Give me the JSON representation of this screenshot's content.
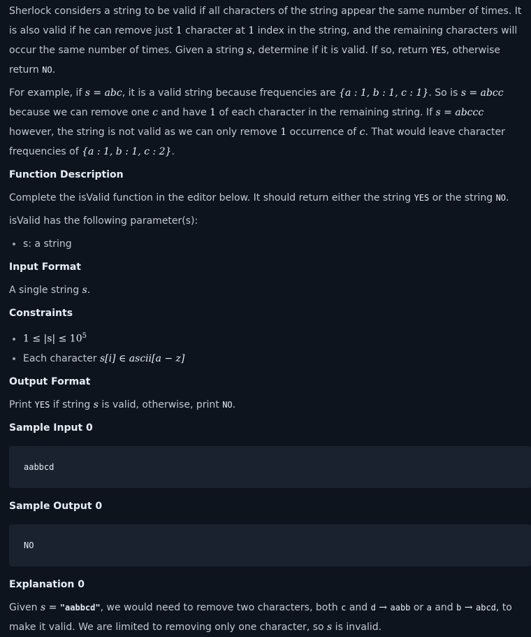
{
  "intro": {
    "p1": {
      "t1": "Sherlock considers a string to be valid if all characters of the string appear the same number of times. It is also valid if he can remove just ",
      "m1": "1",
      "t2": " character at ",
      "m2": "1",
      "t3": " index in the string, and the remaining characters will occur the same number of times. Given a string ",
      "m3": "s",
      "t4": ", determine if it is valid. If so, return ",
      "c1": "YES",
      "t5": ", otherwise return ",
      "c2": "NO",
      "t6": "."
    },
    "p2": {
      "t1": "For example, if ",
      "m1": "s = abc",
      "t2": ", it is a valid string because frequencies are ",
      "m2": "{a : 1, b : 1, c : 1}",
      "t3": ". So is ",
      "m3": "s = abcc",
      "t4": " because we can remove one ",
      "m4": "c",
      "t5": " and have ",
      "m5": "1",
      "t6": " of each character in the remaining string. If ",
      "m6": "s = abccc",
      "t7": " however, the string is not valid as we can only remove ",
      "m7": "1",
      "t8": " occurrence of ",
      "m8": "c",
      "t9": ". That would leave character frequencies of ",
      "m9": "{a : 1, b : 1, c : 2}",
      "t10": "."
    }
  },
  "function_description": {
    "heading": "Function Description",
    "p1": {
      "t1": "Complete the isValid function in the editor below. It should return either the string ",
      "c1": "YES",
      "t2": " or the string ",
      "c2": "NO",
      "t3": "."
    },
    "p2": "isValid has the following parameter(s):",
    "params": [
      "s: a string"
    ]
  },
  "input_format": {
    "heading": "Input Format",
    "t1": "A single string ",
    "m1": "s",
    "t2": "."
  },
  "constraints": {
    "heading": "Constraints",
    "c1": {
      "pre": "1 ≤ |s| ≤ 10",
      "sup": "5"
    },
    "c2": {
      "t1": "Each character ",
      "m1": "s[i] ∈ ascii[a − z]"
    }
  },
  "output_format": {
    "heading": "Output Format",
    "t1": "Print ",
    "c1": "YES",
    "t2": " if string ",
    "m1": "s",
    "t3": " is valid, otherwise, print ",
    "c2": "NO",
    "t4": "."
  },
  "sample_input": {
    "heading": "Sample Input 0",
    "code": "aabbcd"
  },
  "sample_output": {
    "heading": "Sample Output 0",
    "code": "NO"
  },
  "explanation": {
    "heading": "Explanation 0",
    "t1": "Given ",
    "m1": "s = ",
    "s1": "\"aabbcd\"",
    "t2": ", we would need to remove two characters, both ",
    "c1": "c",
    "t3": " and ",
    "c2": "d",
    "arrow1": " → ",
    "c3": "aabb",
    "t4": " or ",
    "c4": "a",
    "t5": " and ",
    "c5": "b",
    "arrow2": " → ",
    "c6": "abcd",
    "t6": ", to make it valid. We are limited to removing only one character, so ",
    "m2": "s",
    "t7": " is invalid."
  }
}
